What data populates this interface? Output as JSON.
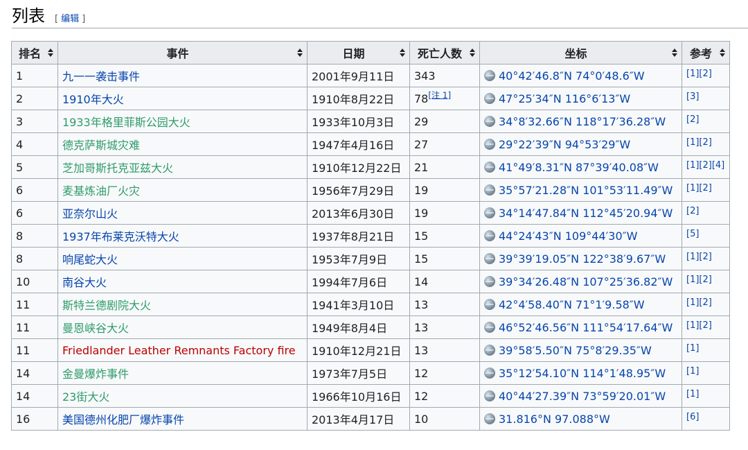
{
  "section": {
    "title": "列表",
    "edit_label": "编辑",
    "bracket_open": "[",
    "bracket_close": "]"
  },
  "table": {
    "headers": [
      "排名",
      "事件",
      "日期",
      "死亡人数",
      "坐标",
      "参考"
    ],
    "rows": [
      {
        "rank": "1",
        "event": "九一一袭击事件",
        "event_color": "blue",
        "date": "2001年9月11日",
        "deaths": "343",
        "note": "",
        "coord": "40°42′46.8″N 74°0′48.6″W",
        "refs": [
          "[1]",
          "[2]"
        ]
      },
      {
        "rank": "2",
        "event": "1910年大火",
        "event_color": "blue",
        "date": "1910年8月22日",
        "deaths": "78",
        "note": "[注 1]",
        "coord": "47°25′34″N 116°6′13″W",
        "refs": [
          "[3]"
        ]
      },
      {
        "rank": "3",
        "event": "1933年格里菲斯公园大火",
        "event_color": "green",
        "date": "1933年10月3日",
        "deaths": "29",
        "note": "",
        "coord": "34°8′32.66″N 118°17′36.28″W",
        "refs": [
          "[2]"
        ]
      },
      {
        "rank": "4",
        "event": "德克萨斯城灾难",
        "event_color": "green",
        "date": "1947年4月16日",
        "deaths": "27",
        "note": "",
        "coord": "29°22′39″N 94°53′29″W",
        "refs": [
          "[1]",
          "[2]"
        ]
      },
      {
        "rank": "5",
        "event": "芝加哥斯托克亚兹大火",
        "event_color": "green",
        "date": "1910年12月22日",
        "deaths": "21",
        "note": "",
        "coord": "41°49′8.31″N 87°39′40.08″W",
        "refs": [
          "[1]",
          "[2]",
          "[4]"
        ]
      },
      {
        "rank": "6",
        "event": "麦基炼油厂火灾",
        "event_color": "green",
        "date": "1956年7月29日",
        "deaths": "19",
        "note": "",
        "coord": "35°57′21.28″N 101°53′11.49″W",
        "refs": [
          "[1]",
          "[2]"
        ]
      },
      {
        "rank": "6",
        "event": "亚奈尔山火",
        "event_color": "blue",
        "date": "2013年6月30日",
        "deaths": "19",
        "note": "",
        "coord": "34°14′47.84″N 112°45′20.94″W",
        "refs": [
          "[2]"
        ]
      },
      {
        "rank": "8",
        "event": "1937年布莱克沃特大火",
        "event_color": "blue",
        "date": "1937年8月21日",
        "deaths": "15",
        "note": "",
        "coord": "44°24′43″N 109°44′30″W",
        "refs": [
          "[5]"
        ]
      },
      {
        "rank": "8",
        "event": "响尾蛇大火",
        "event_color": "blue",
        "date": "1953年7月9日",
        "deaths": "15",
        "note": "",
        "coord": "39°39′19.05″N 122°38′9.67″W",
        "refs": [
          "[1]",
          "[2]"
        ]
      },
      {
        "rank": "10",
        "event": "南谷大火",
        "event_color": "blue",
        "date": "1994年7月6日",
        "deaths": "14",
        "note": "",
        "coord": "39°34′26.48″N 107°25′36.82″W",
        "refs": [
          "[1]",
          "[2]"
        ]
      },
      {
        "rank": "11",
        "event": "斯特兰德剧院大火",
        "event_color": "green",
        "date": "1941年3月10日",
        "deaths": "13",
        "note": "",
        "coord": "42°4′58.40″N 71°1′9.58″W",
        "refs": [
          "[1]",
          "[2]"
        ]
      },
      {
        "rank": "11",
        "event": "曼恩峡谷大火",
        "event_color": "green",
        "date": "1949年8月4日",
        "deaths": "13",
        "note": "",
        "coord": "46°52′46.56″N 111°54′17.64″W",
        "refs": [
          "[1]",
          "[2]"
        ]
      },
      {
        "rank": "11",
        "event": "Friedlander Leather Remnants Factory fire",
        "event_color": "red",
        "date": "1910年12月21日",
        "deaths": "13",
        "note": "",
        "coord": "39°58′5.50″N 75°8′29.35″W",
        "refs": [
          "[1]"
        ]
      },
      {
        "rank": "14",
        "event": "金曼爆炸事件",
        "event_color": "green",
        "date": "1973年7月5日",
        "deaths": "12",
        "note": "",
        "coord": "35°12′54.10″N 114°1′48.95″W",
        "refs": [
          "[1]"
        ]
      },
      {
        "rank": "14",
        "event": "23街大火",
        "event_color": "green",
        "date": "1966年10月16日",
        "deaths": "12",
        "note": "",
        "coord": "40°44′27.39″N 73°59′20.01″W",
        "refs": [
          "[1]"
        ]
      },
      {
        "rank": "16",
        "event": "美国德州化肥厂爆炸事件",
        "event_color": "blue",
        "date": "2013年4月17日",
        "deaths": "10",
        "note": "",
        "coord": "31.816°N 97.088°W",
        "refs": [
          "[6]"
        ]
      }
    ]
  },
  "colors": {
    "link_blue": "#0645ad",
    "link_green": "#2e9c6b",
    "link_red": "#ba0000"
  },
  "icons": {
    "sort": "sort-arrows-icon",
    "coord": "globe-icon"
  }
}
